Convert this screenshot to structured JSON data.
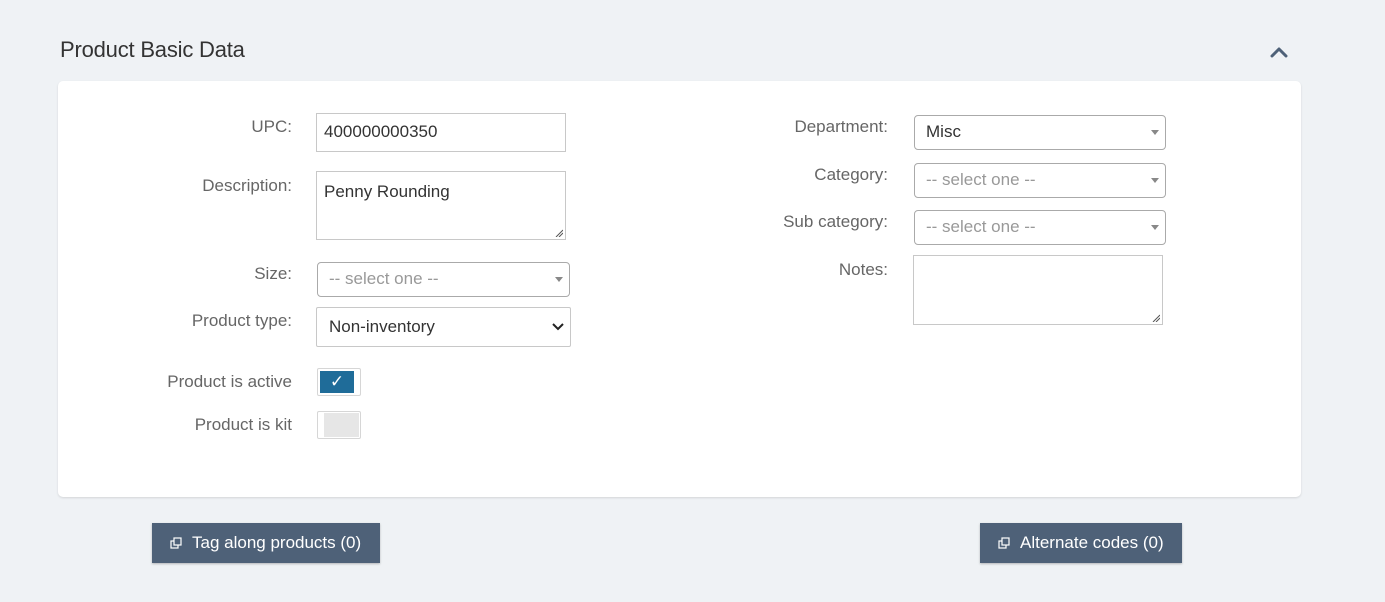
{
  "section": {
    "title": "Product Basic Data",
    "collapse_icon": "chevron-up-icon"
  },
  "left": {
    "upc": {
      "label": "UPC:",
      "value": "400000000350"
    },
    "description": {
      "label": "Description:",
      "value": "Penny Rounding"
    },
    "size": {
      "label": "Size:",
      "value": "-- select one --"
    },
    "product_type": {
      "label": "Product type:",
      "value": "Non-inventory"
    },
    "product_active": {
      "label": "Product is active",
      "checked": true,
      "check_glyph": "✓"
    },
    "product_kit": {
      "label": "Product is kit",
      "checked": false
    }
  },
  "right": {
    "department": {
      "label": "Department:",
      "value": "Misc"
    },
    "category": {
      "label": "Category:",
      "value": "-- select one --"
    },
    "subcategory": {
      "label": "Sub category:",
      "value": "-- select one --"
    },
    "notes": {
      "label": "Notes:",
      "value": ""
    }
  },
  "buttons": {
    "tag_along": {
      "label": "Tag along products (0)",
      "icon": "external-link-icon"
    },
    "alternate_codes": {
      "label": "Alternate codes (0)",
      "icon": "external-link-icon"
    }
  },
  "colors": {
    "page_bg": "#eff2f5",
    "toggle_on": "#1f6c99",
    "button_bg": "#4e6178"
  }
}
